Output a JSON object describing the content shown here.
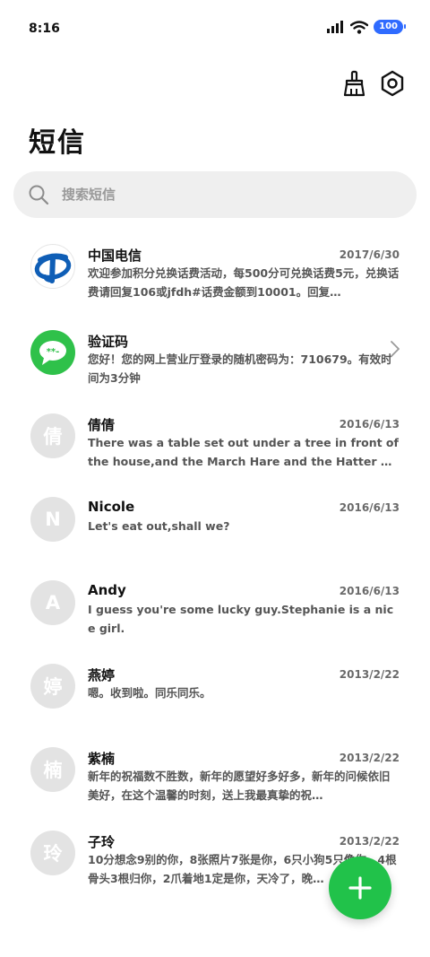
{
  "status_bar": {
    "time": "8:16",
    "battery": "100"
  },
  "header": {
    "title": "短信"
  },
  "search": {
    "placeholder": "搜索短信"
  },
  "messages": [
    {
      "sender": "中国电信",
      "date": "2017/6/30",
      "preview": "欢迎参加积分兑换话费活动，每500分可兑换话费5元，兑换话费请回复106或jfdh#话费金额到10001。回复…",
      "avatar": "china-telecom-logo"
    },
    {
      "sender": "验证码",
      "date": "",
      "preview": "您好！您的网上营业厅登录的随机密码为：710679。有效时间为3分钟",
      "avatar": "message-bubble-icon",
      "avatar_text": "**-"
    },
    {
      "sender": "倩倩",
      "date": "2016/6/13",
      "preview": "There was a table set out under a tree in front of the house,and the March Hare and the Hatter were havi…",
      "avatar_text": "倩"
    },
    {
      "sender": "Nicole",
      "date": "2016/6/13",
      "preview": "Let's eat out,shall we?",
      "avatar_text": "N"
    },
    {
      "sender": "Andy",
      "date": "2016/6/13",
      "preview": "I guess you're some lucky guy.Stephanie is a nice girl.",
      "avatar_text": "A"
    },
    {
      "sender": "燕婷",
      "date": "2013/2/22",
      "preview": "嗯。收到啦。同乐同乐。",
      "avatar_text": "婷"
    },
    {
      "sender": "紫楠",
      "date": "2013/2/22",
      "preview": "新年的祝福数不胜数，新年的愿望好多好多，新年的问候依旧美好，在这个温馨的时刻，送上我最真挚的祝…",
      "avatar_text": "楠"
    },
    {
      "sender": "子玲",
      "date": "2013/2/22",
      "preview": "10分想念9别的你，8张照片7张是你，6只小狗5只像你，4根骨头3根归你，2爪着地1定是你，天冷了，晚…",
      "avatar_text": "玲"
    }
  ],
  "colors": {
    "accent": "#21c24a",
    "battery": "#2f6bff",
    "search_bg": "#efefef"
  }
}
